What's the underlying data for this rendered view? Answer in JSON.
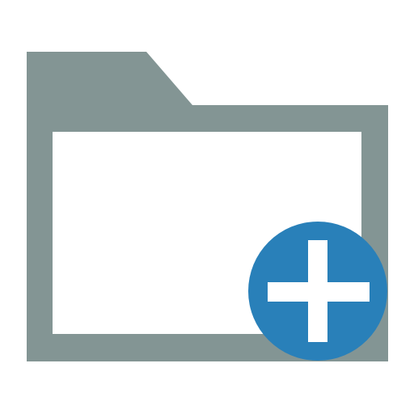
{
  "icon": {
    "name": "new-folder-icon",
    "folder_icon_name": "folder-icon",
    "badge_icon_name": "plus-icon"
  },
  "colors": {
    "background": "#ffffff",
    "folder_frame": "#839594",
    "folder_interior": "#ffffff",
    "badge_fill": "#2980b9",
    "plus": "#ffffff"
  }
}
